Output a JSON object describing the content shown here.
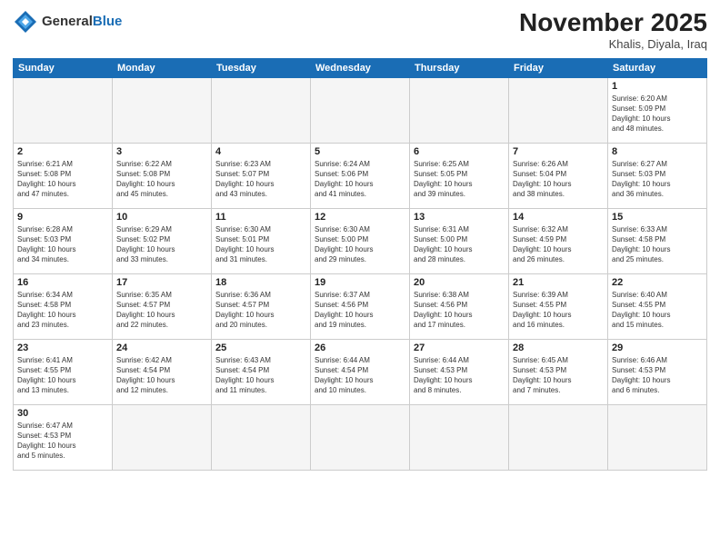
{
  "header": {
    "logo_general": "General",
    "logo_blue": "Blue",
    "month_title": "November 2025",
    "location": "Khalis, Diyala, Iraq"
  },
  "days_of_week": [
    "Sunday",
    "Monday",
    "Tuesday",
    "Wednesday",
    "Thursday",
    "Friday",
    "Saturday"
  ],
  "weeks": [
    [
      {
        "day": "",
        "info": ""
      },
      {
        "day": "",
        "info": ""
      },
      {
        "day": "",
        "info": ""
      },
      {
        "day": "",
        "info": ""
      },
      {
        "day": "",
        "info": ""
      },
      {
        "day": "",
        "info": ""
      },
      {
        "day": "1",
        "info": "Sunrise: 6:20 AM\nSunset: 5:09 PM\nDaylight: 10 hours\nand 48 minutes."
      }
    ],
    [
      {
        "day": "2",
        "info": "Sunrise: 6:21 AM\nSunset: 5:08 PM\nDaylight: 10 hours\nand 47 minutes."
      },
      {
        "day": "3",
        "info": "Sunrise: 6:22 AM\nSunset: 5:08 PM\nDaylight: 10 hours\nand 45 minutes."
      },
      {
        "day": "4",
        "info": "Sunrise: 6:23 AM\nSunset: 5:07 PM\nDaylight: 10 hours\nand 43 minutes."
      },
      {
        "day": "5",
        "info": "Sunrise: 6:24 AM\nSunset: 5:06 PM\nDaylight: 10 hours\nand 41 minutes."
      },
      {
        "day": "6",
        "info": "Sunrise: 6:25 AM\nSunset: 5:05 PM\nDaylight: 10 hours\nand 39 minutes."
      },
      {
        "day": "7",
        "info": "Sunrise: 6:26 AM\nSunset: 5:04 PM\nDaylight: 10 hours\nand 38 minutes."
      },
      {
        "day": "8",
        "info": "Sunrise: 6:27 AM\nSunset: 5:03 PM\nDaylight: 10 hours\nand 36 minutes."
      }
    ],
    [
      {
        "day": "9",
        "info": "Sunrise: 6:28 AM\nSunset: 5:03 PM\nDaylight: 10 hours\nand 34 minutes."
      },
      {
        "day": "10",
        "info": "Sunrise: 6:29 AM\nSunset: 5:02 PM\nDaylight: 10 hours\nand 33 minutes."
      },
      {
        "day": "11",
        "info": "Sunrise: 6:30 AM\nSunset: 5:01 PM\nDaylight: 10 hours\nand 31 minutes."
      },
      {
        "day": "12",
        "info": "Sunrise: 6:30 AM\nSunset: 5:00 PM\nDaylight: 10 hours\nand 29 minutes."
      },
      {
        "day": "13",
        "info": "Sunrise: 6:31 AM\nSunset: 5:00 PM\nDaylight: 10 hours\nand 28 minutes."
      },
      {
        "day": "14",
        "info": "Sunrise: 6:32 AM\nSunset: 4:59 PM\nDaylight: 10 hours\nand 26 minutes."
      },
      {
        "day": "15",
        "info": "Sunrise: 6:33 AM\nSunset: 4:58 PM\nDaylight: 10 hours\nand 25 minutes."
      }
    ],
    [
      {
        "day": "16",
        "info": "Sunrise: 6:34 AM\nSunset: 4:58 PM\nDaylight: 10 hours\nand 23 minutes."
      },
      {
        "day": "17",
        "info": "Sunrise: 6:35 AM\nSunset: 4:57 PM\nDaylight: 10 hours\nand 22 minutes."
      },
      {
        "day": "18",
        "info": "Sunrise: 6:36 AM\nSunset: 4:57 PM\nDaylight: 10 hours\nand 20 minutes."
      },
      {
        "day": "19",
        "info": "Sunrise: 6:37 AM\nSunset: 4:56 PM\nDaylight: 10 hours\nand 19 minutes."
      },
      {
        "day": "20",
        "info": "Sunrise: 6:38 AM\nSunset: 4:56 PM\nDaylight: 10 hours\nand 17 minutes."
      },
      {
        "day": "21",
        "info": "Sunrise: 6:39 AM\nSunset: 4:55 PM\nDaylight: 10 hours\nand 16 minutes."
      },
      {
        "day": "22",
        "info": "Sunrise: 6:40 AM\nSunset: 4:55 PM\nDaylight: 10 hours\nand 15 minutes."
      }
    ],
    [
      {
        "day": "23",
        "info": "Sunrise: 6:41 AM\nSunset: 4:55 PM\nDaylight: 10 hours\nand 13 minutes."
      },
      {
        "day": "24",
        "info": "Sunrise: 6:42 AM\nSunset: 4:54 PM\nDaylight: 10 hours\nand 12 minutes."
      },
      {
        "day": "25",
        "info": "Sunrise: 6:43 AM\nSunset: 4:54 PM\nDaylight: 10 hours\nand 11 minutes."
      },
      {
        "day": "26",
        "info": "Sunrise: 6:44 AM\nSunset: 4:54 PM\nDaylight: 10 hours\nand 10 minutes."
      },
      {
        "day": "27",
        "info": "Sunrise: 6:44 AM\nSunset: 4:53 PM\nDaylight: 10 hours\nand 8 minutes."
      },
      {
        "day": "28",
        "info": "Sunrise: 6:45 AM\nSunset: 4:53 PM\nDaylight: 10 hours\nand 7 minutes."
      },
      {
        "day": "29",
        "info": "Sunrise: 6:46 AM\nSunset: 4:53 PM\nDaylight: 10 hours\nand 6 minutes."
      }
    ],
    [
      {
        "day": "30",
        "info": "Sunrise: 6:47 AM\nSunset: 4:53 PM\nDaylight: 10 hours\nand 5 minutes."
      },
      {
        "day": "",
        "info": ""
      },
      {
        "day": "",
        "info": ""
      },
      {
        "day": "",
        "info": ""
      },
      {
        "day": "",
        "info": ""
      },
      {
        "day": "",
        "info": ""
      },
      {
        "day": "",
        "info": ""
      }
    ]
  ]
}
